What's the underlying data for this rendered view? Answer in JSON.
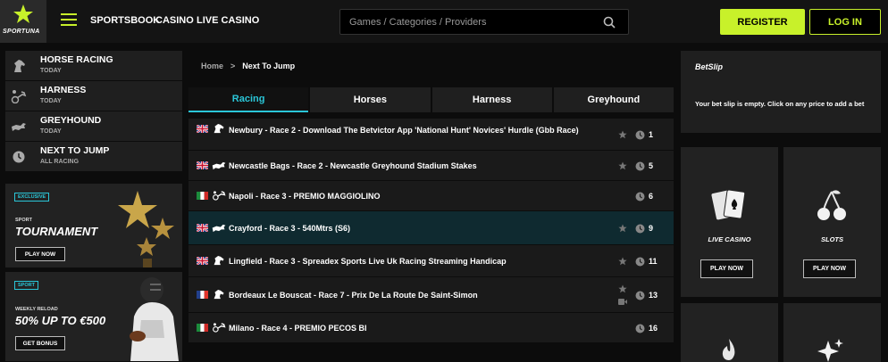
{
  "brand": {
    "name": "SPORTUNA",
    "accent": "#c8f12a",
    "highlight": "#2ac6d8"
  },
  "header": {
    "menu_icon": "hamburger-icon",
    "nav": [
      "SPORTSBOOK",
      "CASINO",
      "LIVE CASINO"
    ],
    "search_placeholder": "Games / Categories / Providers",
    "register_label": "REGISTER",
    "login_label": "LOG IN"
  },
  "sidebar": {
    "items": [
      {
        "title": "HORSE RACING",
        "sub": "TODAY",
        "icon": "horse-head-icon"
      },
      {
        "title": "HARNESS",
        "sub": "TODAY",
        "icon": "harness-icon"
      },
      {
        "title": "GREYHOUND",
        "sub": "TODAY",
        "icon": "greyhound-icon"
      },
      {
        "title": "NEXT TO JUMP",
        "sub": "ALL RACING",
        "icon": "clock-icon"
      }
    ],
    "promos": [
      {
        "badge": "EXCLUSIVE",
        "small": "SPORT",
        "big": "TOURNAMENT",
        "button": "PLAY NOW"
      },
      {
        "badge": "SPORT",
        "small": "WEEKLY RELOAD",
        "big": "50% UP TO €500",
        "button": "GET BONUS"
      }
    ]
  },
  "main": {
    "breadcrumb": {
      "home": "Home",
      "separator": ">",
      "current": "Next To Jump"
    },
    "tabs": [
      "Racing",
      "Horses",
      "Harness",
      "Greyhound"
    ],
    "active_tab": "Racing",
    "races": [
      {
        "flag": "uk",
        "type": "horse",
        "name": "Newbury - Race 2 - Download The Betvictor App 'National Hunt' Novices' Hurdle (Gbb Race)",
        "mins": "1",
        "star": true,
        "cam": false
      },
      {
        "flag": "uk",
        "type": "greyhound",
        "name": "Newcastle Bags - Race 2 - Newcastle Greyhound Stadium Stakes",
        "mins": "5",
        "star": true,
        "cam": false
      },
      {
        "flag": "it",
        "type": "harness",
        "name": "Napoli - Race 3 - PREMIO MAGGIOLINO",
        "mins": "6",
        "star": false,
        "cam": false
      },
      {
        "flag": "uk",
        "type": "greyhound",
        "name": "Crayford - Race 3 - 540Mtrs (S6)",
        "mins": "9",
        "star": true,
        "cam": false
      },
      {
        "flag": "uk",
        "type": "horse",
        "name": "Lingfield - Race 3 - Spreadex Sports Live Uk Racing Streaming Handicap",
        "mins": "11",
        "star": true,
        "cam": false
      },
      {
        "flag": "fr",
        "type": "horse",
        "name": "Bordeaux Le Bouscat - Race 7 - Prix De La Route De Saint-Simon",
        "mins": "13",
        "star": true,
        "cam": true
      },
      {
        "flag": "it",
        "type": "harness",
        "name": "Milano - Race 4 - PREMIO PECOS BI",
        "mins": "16",
        "star": false,
        "cam": false
      }
    ]
  },
  "betslip": {
    "title": "BetSlip",
    "empty_message": "Your bet slip is empty. Click on any price to add a bet"
  },
  "games": [
    {
      "label": "LIVE CASINO",
      "button": "PLAY NOW",
      "icon": "playing-cards-icon"
    },
    {
      "label": "SLOTS",
      "button": "PLAY NOW",
      "icon": "cherries-icon"
    },
    {
      "label": "",
      "button": "",
      "icon": "flame-icon"
    },
    {
      "label": "",
      "button": "",
      "icon": "sparkle-icon"
    }
  ]
}
